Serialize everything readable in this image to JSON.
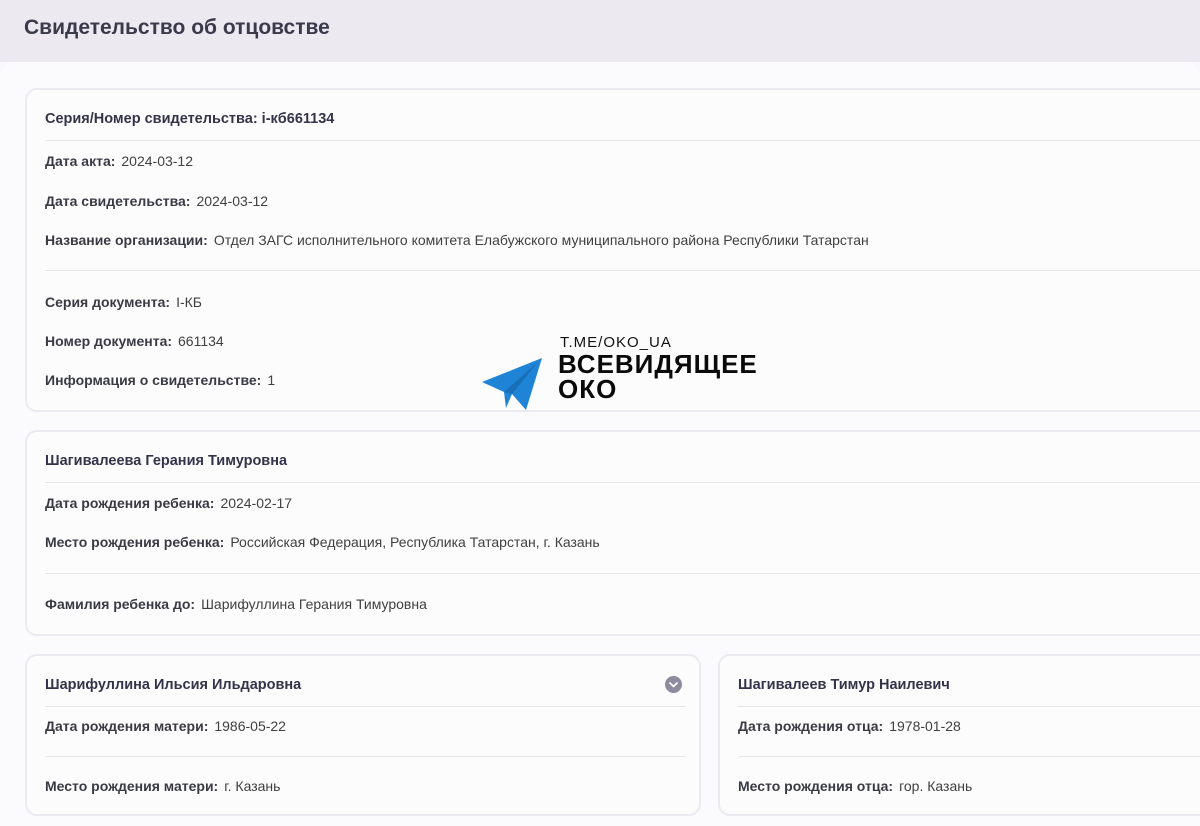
{
  "page": {
    "title": "Свидетельство об отцовстве"
  },
  "certificate": {
    "title": "Серия/Номер свидетельства: i-кб661134",
    "act_date_label": "Дата акта:",
    "act_date": "2024-03-12",
    "cert_date_label": "Дата свидетельства:",
    "cert_date": "2024-03-12",
    "org_label": "Название организации:",
    "org": "Отдел ЗАГС исполнительного комитета Елабужского муниципального района Республики Татарстан",
    "doc_series_label": "Серия документа:",
    "doc_series": "I-КБ",
    "doc_number_label": "Номер документа:",
    "doc_number": "661134",
    "info_label": "Информация о свидетельстве:",
    "info": "1"
  },
  "child": {
    "name": "Шагивалеева Герания Тимуровна",
    "birth_date_label": "Дата рождения ребенка:",
    "birth_date": "2024-02-17",
    "birth_place_label": "Место рождения ребенка:",
    "birth_place": "Российская Федерация, Республика Татарстан, г. Казань",
    "prev_surname_label": "Фамилия ребенка до:",
    "prev_surname": "Шарифуллина Герания Тимуровна"
  },
  "mother": {
    "name": "Шарифуллина Ильсия Ильдаровна",
    "birth_date_label": "Дата рождения матери:",
    "birth_date": "1986-05-22",
    "birth_place_label": "Место рождения матери:",
    "birth_place": "г. Казань"
  },
  "father": {
    "name": "Шагивалеев Тимур Наилевич",
    "birth_date_label": "Дата рождения отца:",
    "birth_date": "1978-01-28",
    "birth_place_label": "Место рождения отца:",
    "birth_place": "гор. Казань"
  },
  "watermark": {
    "handle": "T.ME/OKO_UA",
    "name_line1": "ВСЕВИДЯЩЕЕ",
    "name_line2": "ОКО",
    "icon": "telegram-plane-icon",
    "color": "#1f84d6"
  }
}
